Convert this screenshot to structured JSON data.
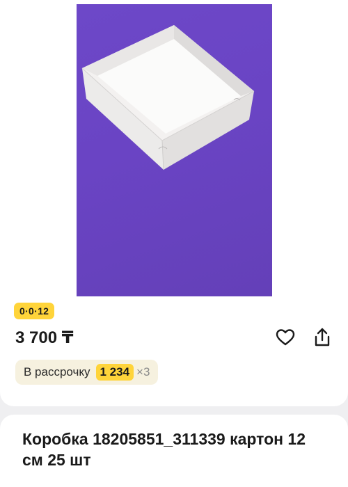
{
  "product": {
    "installment_badge": "0·0·12",
    "price": "3 700 ₸",
    "installment": {
      "label": "В рассрочку",
      "amount": "1 234",
      "times": "×3"
    },
    "title": "Коробка 18205851_311339 картон 12 см 25 шт"
  },
  "icons": {
    "favorite": "heart-outline-icon",
    "share": "share-icon"
  },
  "colors": {
    "accent_yellow": "#ffd43a",
    "installment_bg": "#f6f1df",
    "photo_background": "#6a44c4"
  }
}
